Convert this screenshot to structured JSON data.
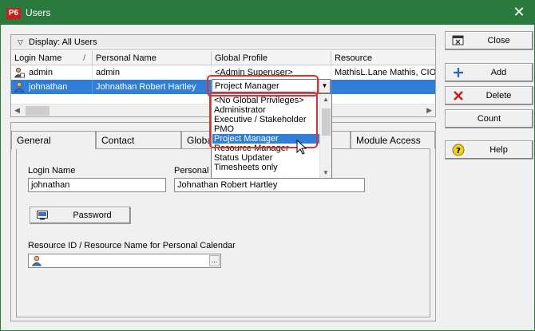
{
  "window": {
    "logo": "P6",
    "title": "Users",
    "close_glyph": "✕"
  },
  "sidebar": {
    "close_label": "Close",
    "add_label": "Add",
    "delete_label": "Delete",
    "count_label": "Count",
    "help_label": "Help"
  },
  "grid": {
    "display_label": "Display: All Users",
    "columns": [
      "Login Name",
      "/",
      "Personal Name",
      "Global Profile",
      "Resource"
    ],
    "rows": [
      {
        "login": "admin",
        "personal": "admin",
        "profile": "<Admin Superuser>",
        "resource": "MathisL.Lane Mathis, CIO"
      },
      {
        "login": "johnathan",
        "personal": "Johnathan Robert Hartley",
        "profile": "Project Manager",
        "resource": ""
      }
    ]
  },
  "dropdown": {
    "options": [
      "<No Global Privileges>",
      "Administrator",
      "Executive / Stakeholder",
      "PMO",
      "Project Manager",
      "Resource Manager",
      "Status Updater",
      "Timesheets only"
    ],
    "highlighted": "Project Manager"
  },
  "tabs": [
    "General",
    "Contact",
    "Global",
    "Module Access"
  ],
  "general": {
    "login_label": "Login Name",
    "login_value": "johnathan",
    "personal_label": "Personal N",
    "personal_value": "Johnathan Robert Hartley",
    "password_label": "Password",
    "resource_label": "Resource ID / Resource Name for Personal Calendar",
    "resource_value": "",
    "ellipsis": "..."
  },
  "colors": {
    "titlebar": "#2b7a3d",
    "selection": "#2f7fd8",
    "highlight_box": "#e03030"
  }
}
